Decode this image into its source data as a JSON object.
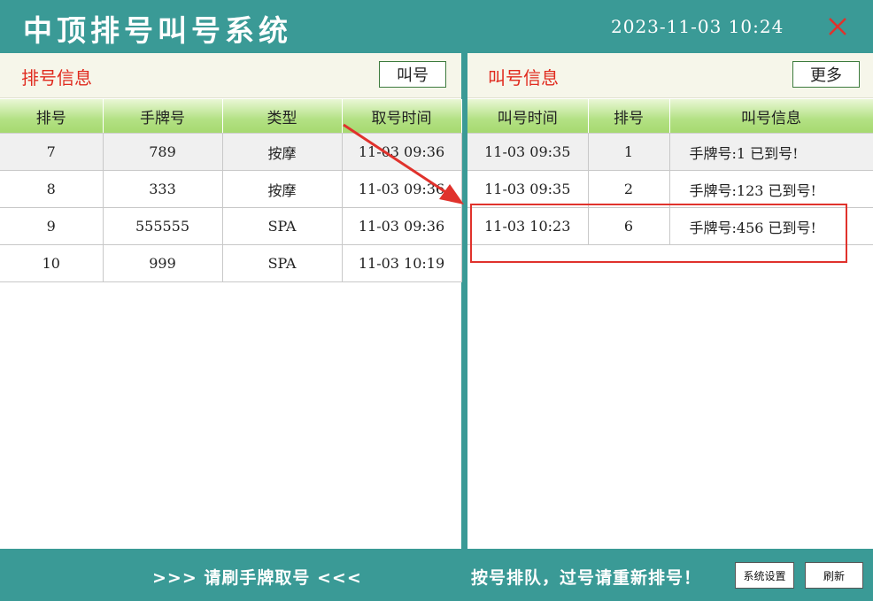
{
  "app": {
    "title": "中顶排号叫号系统",
    "datetime": "2023-11-03  10:24"
  },
  "queue_panel": {
    "title": "排号信息",
    "call_button": "叫号",
    "columns": [
      "排号",
      "手牌号",
      "类型",
      "取号时间"
    ],
    "rows": [
      [
        "7",
        "789",
        "按摩",
        "11-03 09:36"
      ],
      [
        "8",
        "333",
        "按摩",
        "11-03 09:36"
      ],
      [
        "9",
        "555555",
        "SPA",
        "11-03 09:36"
      ],
      [
        "10",
        "999",
        "SPA",
        "11-03 10:19"
      ]
    ]
  },
  "called_panel": {
    "title": "叫号信息",
    "more_button": "更多",
    "columns": [
      "叫号时间",
      "排号",
      "叫号信息"
    ],
    "rows": [
      [
        "11-03 09:35",
        "1",
        "手牌号:1 已到号!"
      ],
      [
        "11-03 09:35",
        "2",
        "手牌号:123 已到号!"
      ],
      [
        "11-03 10:23",
        "6",
        "手牌号:456 已到号!"
      ]
    ]
  },
  "footer": {
    "prompt": ">>>  请刷手牌取号  <<<",
    "notice": "按号排队，过号请重新排号！",
    "settings_button": "系统设置",
    "refresh_button": "刷新"
  },
  "colors": {
    "teal": "#3a9a96",
    "accent_red": "#e0322c",
    "header_green": "#b3e184"
  },
  "icons": {
    "close": "close-icon"
  }
}
